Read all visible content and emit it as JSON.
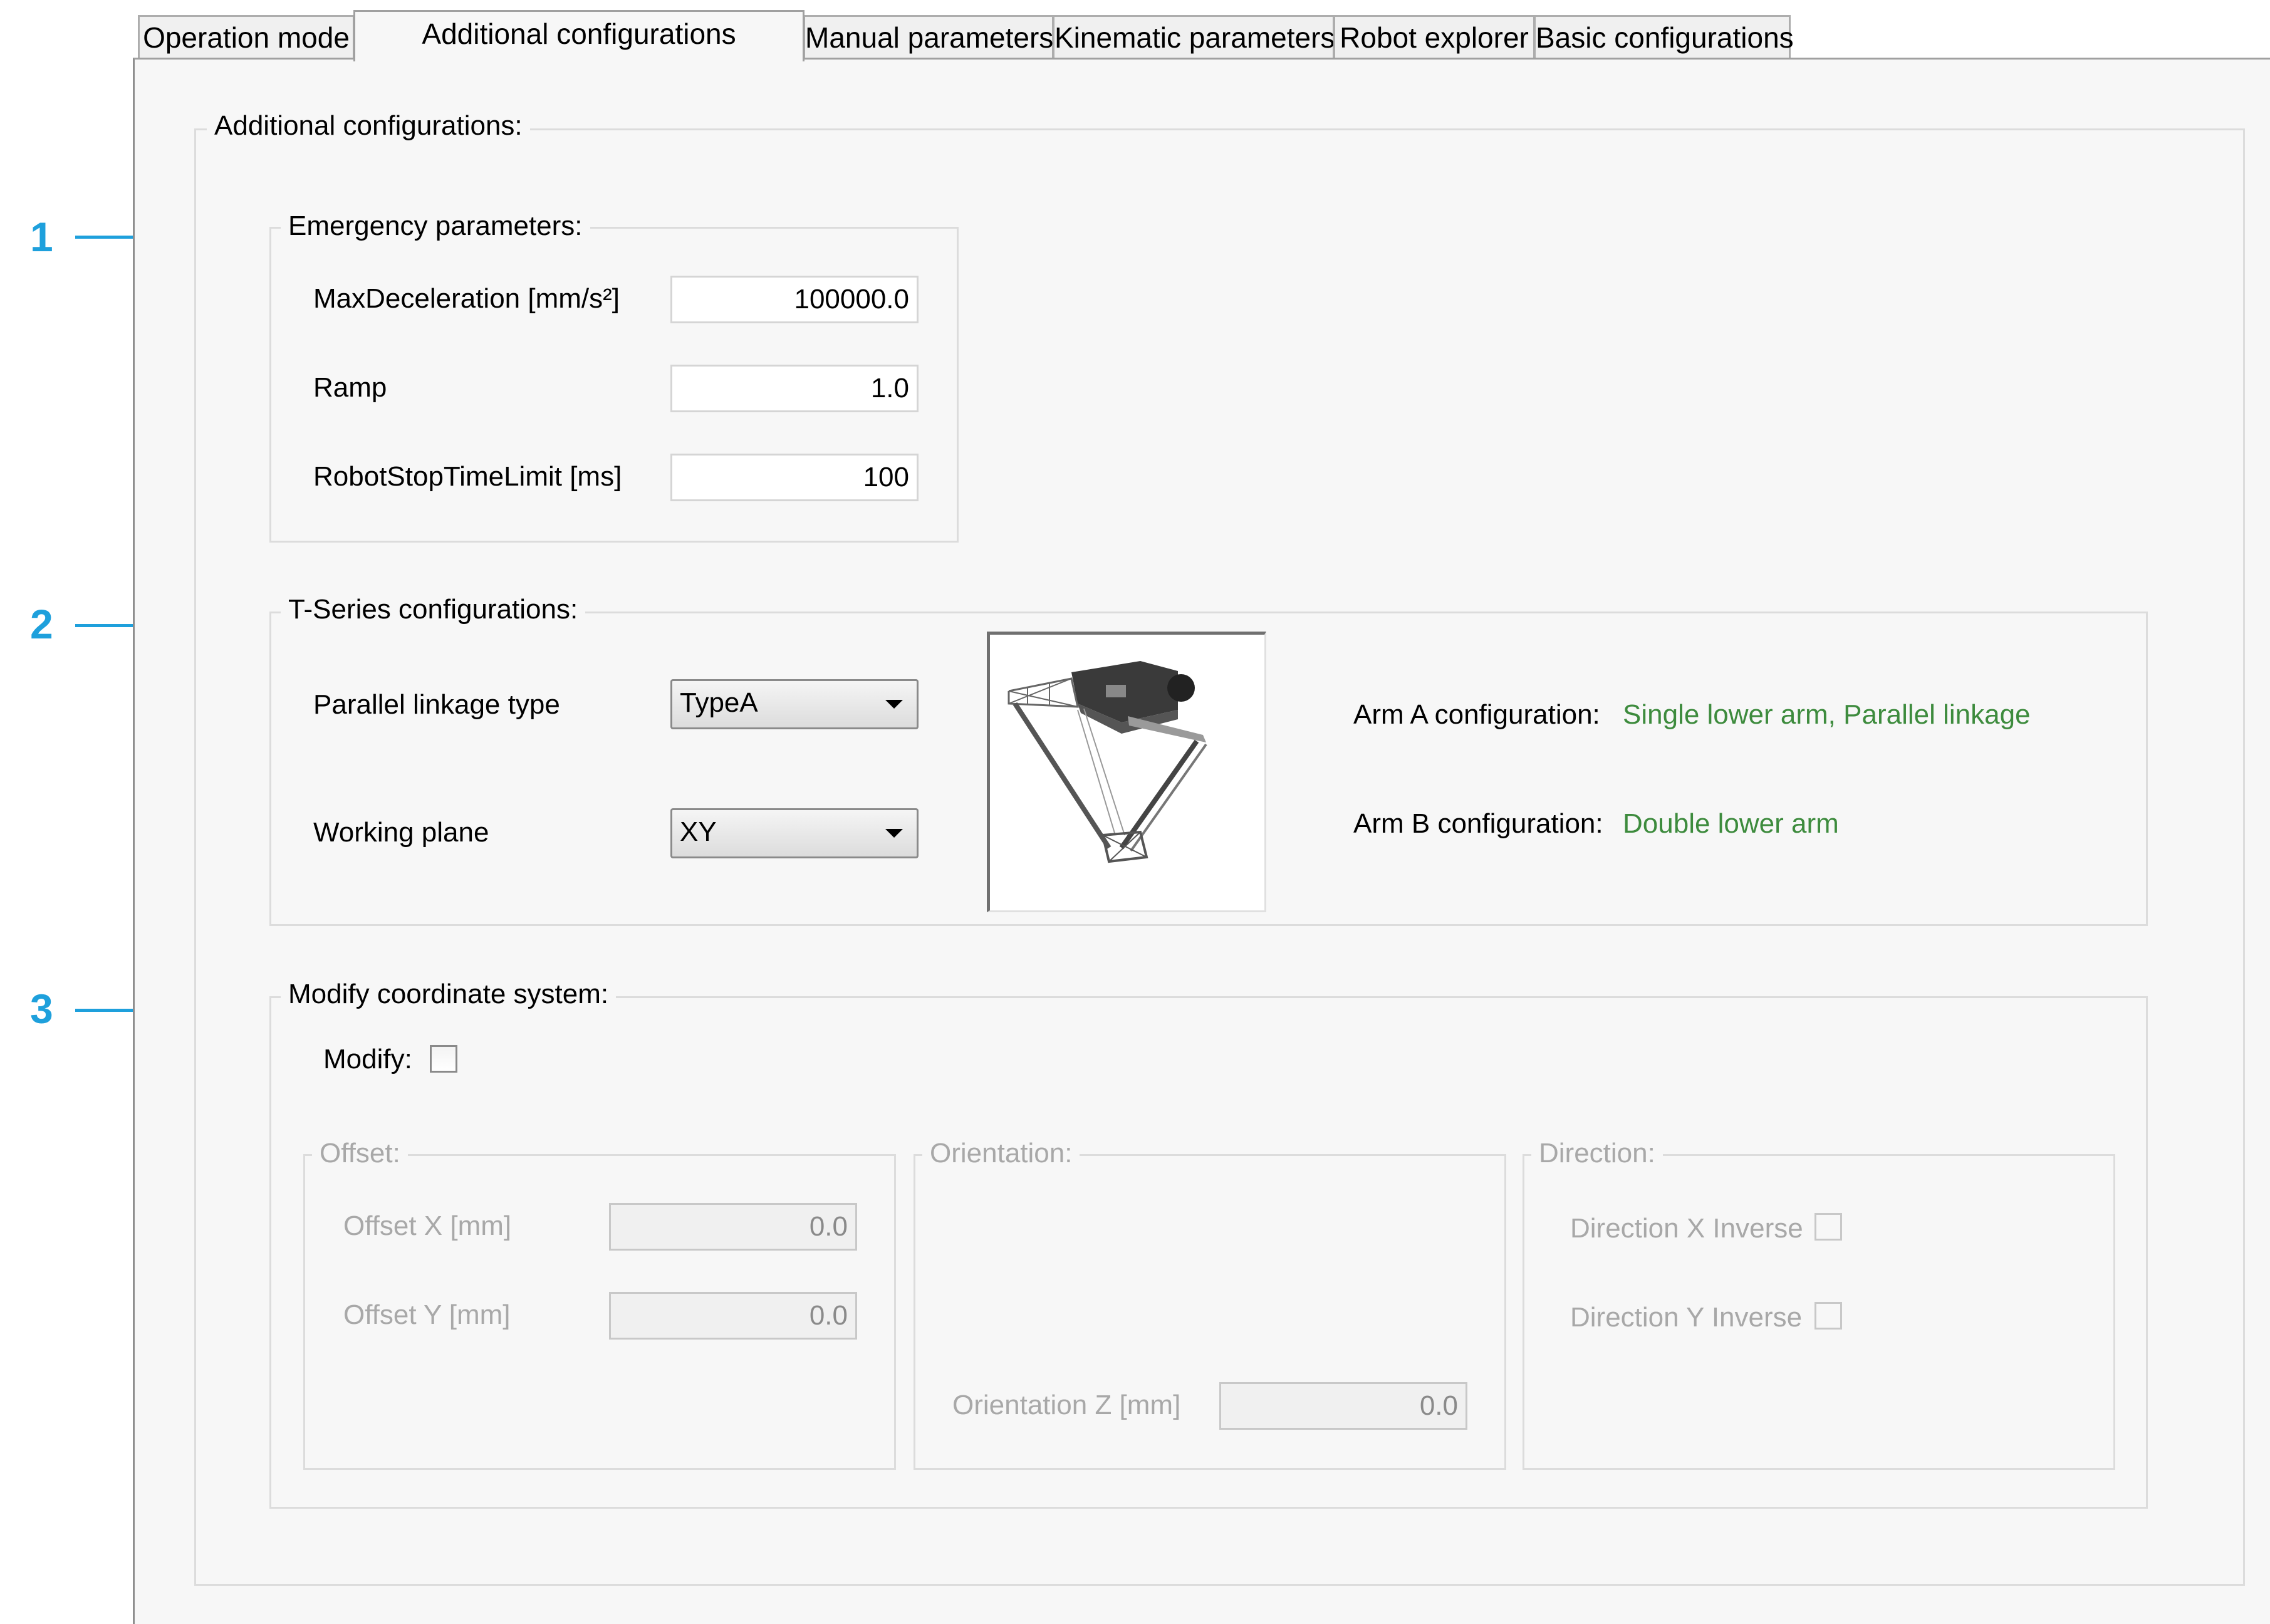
{
  "tabs": [
    {
      "label": "Operation mode"
    },
    {
      "label": "Additional configurations",
      "active": true
    },
    {
      "label": "Manual parameters"
    },
    {
      "label": "Kinematic parameters"
    },
    {
      "label": "Robot explorer"
    },
    {
      "label": "Basic configurations"
    }
  ],
  "main": {
    "title": "Additional configurations:"
  },
  "callouts": [
    "1",
    "2",
    "3"
  ],
  "emergency": {
    "title": "Emergency parameters:",
    "max_decel_label": "MaxDeceleration [mm/s²]",
    "max_decel_value": "100000.0",
    "ramp_label": "Ramp",
    "ramp_value": "1.0",
    "stop_time_label": "RobotStopTimeLimit [ms]",
    "stop_time_value": "100"
  },
  "tseries": {
    "title": "T-Series configurations:",
    "linkage_label": "Parallel linkage type",
    "linkage_value": "TypeA",
    "plane_label": "Working plane",
    "plane_value": "XY",
    "arm_a_label": "Arm A configuration:",
    "arm_a_value": "Single lower arm, Parallel linkage",
    "arm_b_label": "Arm B configuration:",
    "arm_b_value": "Double lower arm"
  },
  "coord": {
    "title": "Modify coordinate system:",
    "modify_label": "Modify:",
    "modify_checked": false,
    "offset": {
      "title": "Offset:",
      "x_label": "Offset X [mm]",
      "x_value": "0.0",
      "y_label": "Offset Y [mm]",
      "y_value": "0.0"
    },
    "orientation": {
      "title": "Orientation:",
      "z_label": "Orientation Z [mm]",
      "z_value": "0.0"
    },
    "direction": {
      "title": "Direction:",
      "x_inverse_label": "Direction X Inverse",
      "y_inverse_label": "Direction Y Inverse"
    }
  },
  "colors": {
    "accent": "#1ea0dc",
    "status_green": "#3d8b3d"
  }
}
